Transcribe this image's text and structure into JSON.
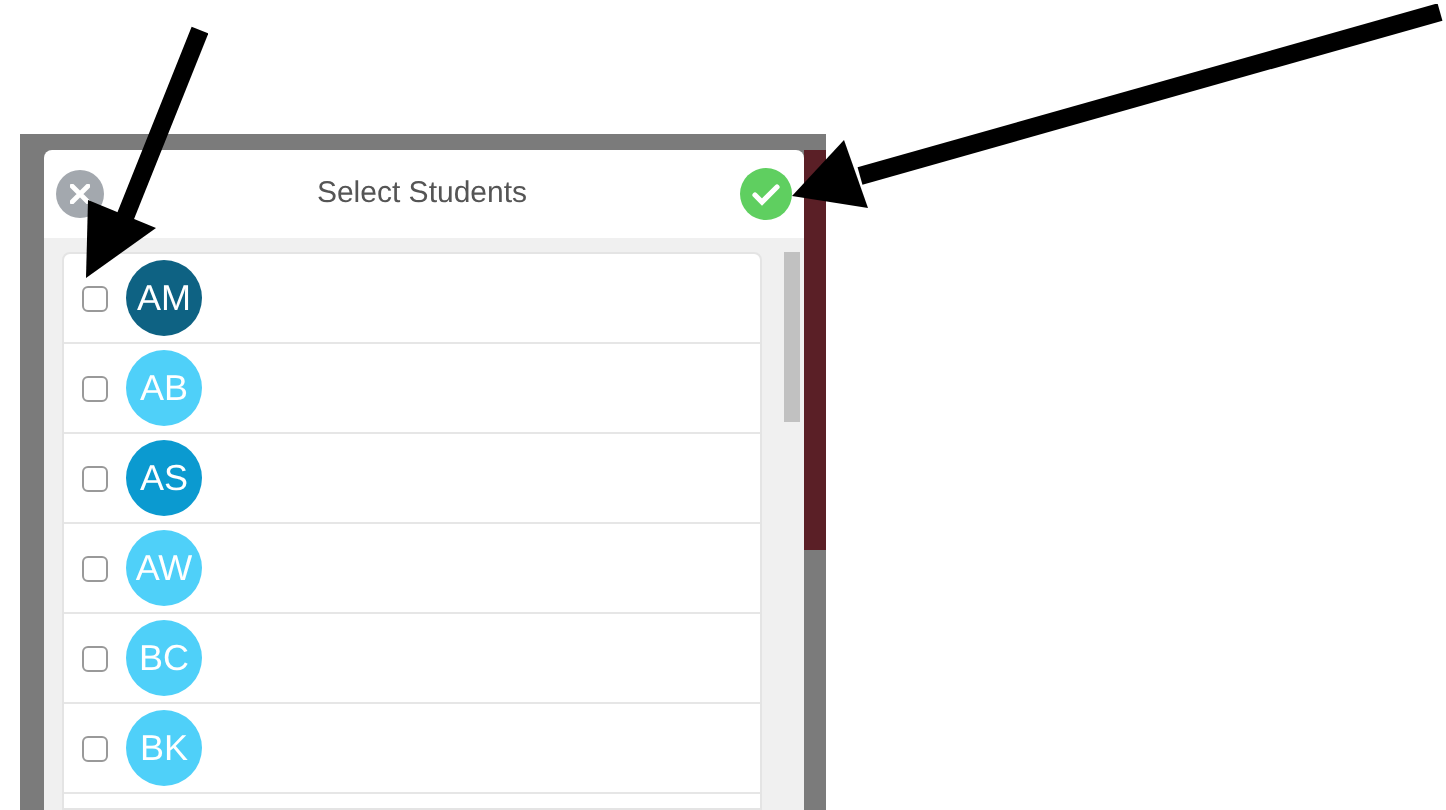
{
  "dialog": {
    "title": "Select Students"
  },
  "students": [
    {
      "initials": "AM",
      "color": "#0e6283",
      "checked": false
    },
    {
      "initials": "AB",
      "color": "#4fd0f9",
      "checked": false
    },
    {
      "initials": "AS",
      "color": "#0b9ad0",
      "checked": false
    },
    {
      "initials": "AW",
      "color": "#4fd0f9",
      "checked": false
    },
    {
      "initials": "BC",
      "color": "#4fd0f9",
      "checked": false
    },
    {
      "initials": "BK",
      "color": "#4fd0f9",
      "checked": false
    }
  ]
}
